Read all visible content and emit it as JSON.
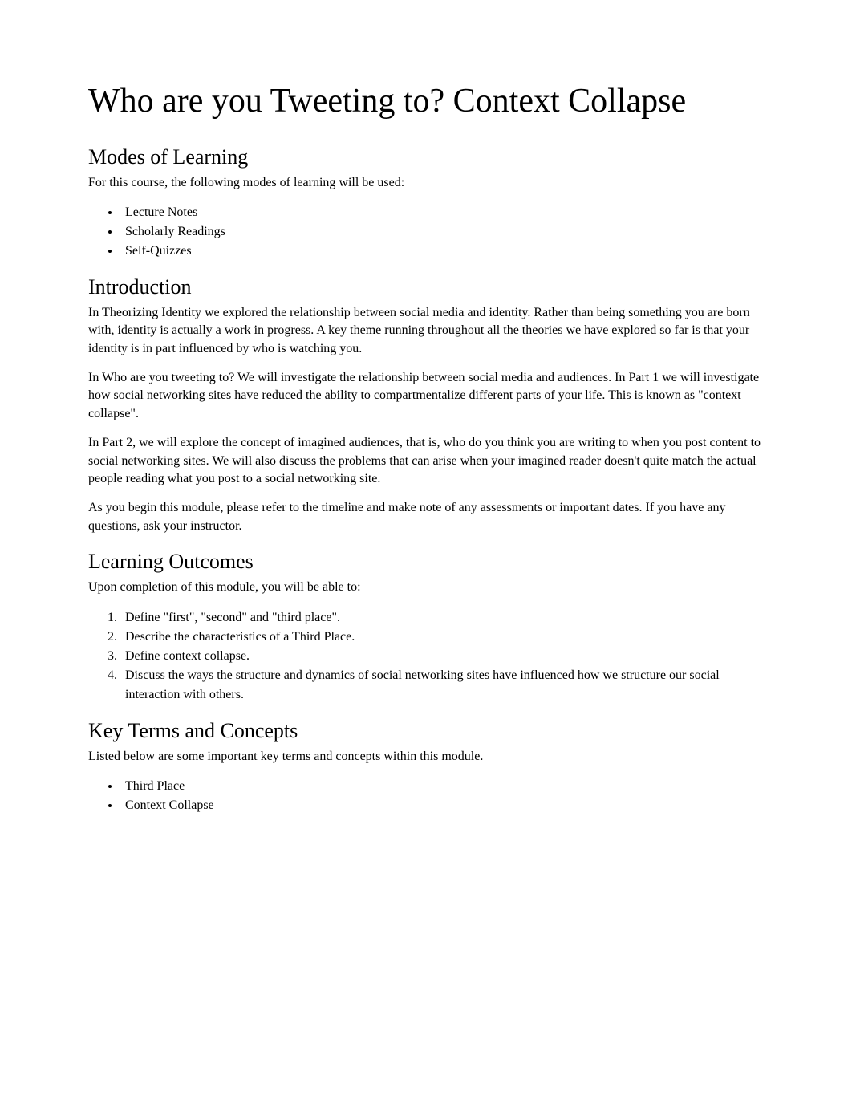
{
  "title": "Who are you Tweeting to? Context Collapse",
  "sections": {
    "modesOfLearning": {
      "heading": "Modes of Learning",
      "intro": "For this course, the following modes of learning will be used:",
      "items": [
        "Lecture Notes",
        "Scholarly Readings",
        "Self-Quizzes"
      ]
    },
    "introduction": {
      "heading": "Introduction",
      "paragraphs": [
        "In Theorizing Identity we explored the relationship between social media and identity. Rather than being something you are born with, identity is actually a work in progress. A key theme running throughout all the theories we have explored so far is that your identity is in part influenced by who is watching you.",
        "In Who are you tweeting to? We will investigate the relationship between social media and audiences. In Part 1 we will investigate how social networking sites have reduced the ability to compartmentalize different parts of your life. This is known as \"context collapse\".",
        "In Part 2, we will explore the concept of imagined audiences, that is, who do you think you are writing to when you post content to social networking sites. We will also discuss the problems that can arise when your imagined reader doesn't quite match the actual people reading what you post to a social networking site.",
        "As you begin this module, please refer to the timeline and make note of any assessments or important dates. If you have any questions, ask your instructor."
      ]
    },
    "learningOutcomes": {
      "heading": "Learning Outcomes",
      "intro": "Upon completion of this module, you will be able to:",
      "items": [
        "Define \"first\", \"second\" and \"third place\".",
        "Describe the characteristics of a Third Place.",
        "Define context collapse.",
        "Discuss the ways the structure and dynamics of social networking sites have influenced how we structure our social interaction with others."
      ]
    },
    "keyTerms": {
      "heading": "Key Terms and Concepts",
      "intro": "Listed below are some important key terms and concepts within this module.",
      "items": [
        "Third Place",
        "Context Collapse"
      ]
    }
  }
}
